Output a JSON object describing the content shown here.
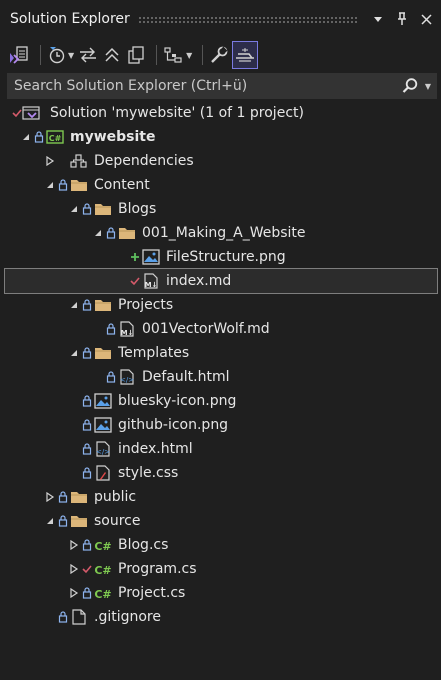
{
  "panel": {
    "title": "Solution Explorer"
  },
  "title_buttons": {
    "menu_icon": "chevron-down-icon",
    "pin_icon": "pin-icon",
    "close_icon": "close-icon"
  },
  "toolbar": {
    "items": [
      {
        "name": "switch-views-icon"
      },
      {
        "name": "pending-changes-filter-icon"
      },
      {
        "name": "sync-with-active-document-icon"
      },
      {
        "name": "collapse-all-icon"
      },
      {
        "name": "show-all-files-icon"
      },
      {
        "name": "view-class-diagram-icon"
      },
      {
        "name": "properties-icon"
      },
      {
        "name": "preview-selected-items-icon",
        "active": true
      }
    ]
  },
  "search": {
    "placeholder": "Search Solution Explorer (Ctrl+ü)"
  },
  "colors": {
    "accent": "#7a7ae0",
    "background": "#1f1f1f",
    "lock": "#8eb4ee",
    "check": "#d45a6a",
    "added": "#5fbf5f",
    "folder": "#dcb67a"
  },
  "tree": [
    {
      "label": "Solution 'mywebsite' (1 of 1 project)",
      "depth": 0,
      "twisty": "none",
      "status": "check",
      "icon": "solution-icon"
    },
    {
      "label": "mywebsite",
      "depth": 0,
      "twisty": "expanded",
      "status": "lock",
      "icon": "csharp-project-icon",
      "bold": true
    },
    {
      "label": "Dependencies",
      "depth": 1,
      "twisty": "collapsed",
      "status": "none",
      "icon": "dependencies-icon"
    },
    {
      "label": "Content",
      "depth": 1,
      "twisty": "expanded",
      "status": "lock",
      "icon": "folder-icon"
    },
    {
      "label": "Blogs",
      "depth": 2,
      "twisty": "expanded",
      "status": "lock",
      "icon": "folder-icon"
    },
    {
      "label": "001_Making_A_Website",
      "depth": 3,
      "twisty": "expanded",
      "status": "lock",
      "icon": "folder-icon"
    },
    {
      "label": "FileStructure.png",
      "depth": 4,
      "twisty": "none",
      "status": "plus",
      "icon": "image-file-icon"
    },
    {
      "label": "index.md",
      "depth": 4,
      "twisty": "none",
      "status": "check",
      "icon": "markdown-file-icon",
      "selected": true
    },
    {
      "label": "Projects",
      "depth": 2,
      "twisty": "expanded",
      "status": "lock",
      "icon": "folder-icon"
    },
    {
      "label": "001VectorWolf.md",
      "depth": 3,
      "twisty": "none",
      "status": "lock",
      "icon": "markdown-file-icon"
    },
    {
      "label": "Templates",
      "depth": 2,
      "twisty": "expanded",
      "status": "lock",
      "icon": "folder-icon"
    },
    {
      "label": "Default.html",
      "depth": 3,
      "twisty": "none",
      "status": "lock",
      "icon": "html-file-icon"
    },
    {
      "label": "bluesky-icon.png",
      "depth": 2,
      "twisty": "none",
      "status": "lock",
      "icon": "image-file-icon"
    },
    {
      "label": "github-icon.png",
      "depth": 2,
      "twisty": "none",
      "status": "lock",
      "icon": "image-file-icon"
    },
    {
      "label": "index.html",
      "depth": 2,
      "twisty": "none",
      "status": "lock",
      "icon": "html-file-icon"
    },
    {
      "label": "style.css",
      "depth": 2,
      "twisty": "none",
      "status": "lock",
      "icon": "css-file-icon"
    },
    {
      "label": "public",
      "depth": 1,
      "twisty": "collapsed",
      "status": "lock",
      "icon": "folder-icon"
    },
    {
      "label": "source",
      "depth": 1,
      "twisty": "expanded",
      "status": "lock",
      "icon": "folder-icon"
    },
    {
      "label": "Blog.cs",
      "depth": 2,
      "twisty": "collapsed",
      "status": "lock",
      "icon": "csharp-file-icon"
    },
    {
      "label": "Program.cs",
      "depth": 2,
      "twisty": "collapsed",
      "status": "check",
      "icon": "csharp-file-icon"
    },
    {
      "label": "Project.cs",
      "depth": 2,
      "twisty": "collapsed",
      "status": "lock",
      "icon": "csharp-file-icon"
    },
    {
      "label": ".gitignore",
      "depth": 1,
      "twisty": "none",
      "status": "lock",
      "icon": "generic-file-icon"
    }
  ]
}
